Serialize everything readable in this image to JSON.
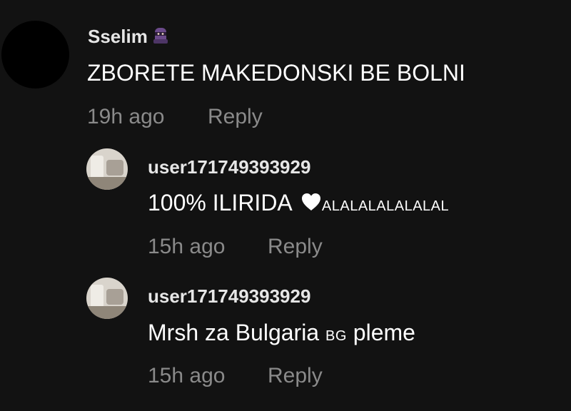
{
  "comments": [
    {
      "username": "Sselim",
      "username_icon": "ninja-icon",
      "text": "ZBORETE MAKEDONSKI BE BOLNI",
      "time": "19h ago",
      "reply_label": "Reply"
    },
    {
      "username": "user171749393929",
      "text_main": "100% ILIRIDA",
      "text_icon": "white-heart-icon",
      "text_suffix": "ALALALALALALAL",
      "time": "15h ago",
      "reply_label": "Reply"
    },
    {
      "username": "user171749393929",
      "text_main": "Mrsh za Bulgaria",
      "text_flag": "BG",
      "text_suffix": "pleme",
      "time": "15h ago",
      "reply_label": "Reply"
    }
  ],
  "colors": {
    "background": "#121212",
    "text": "#ffffff",
    "secondary": "#8a8a8a"
  }
}
